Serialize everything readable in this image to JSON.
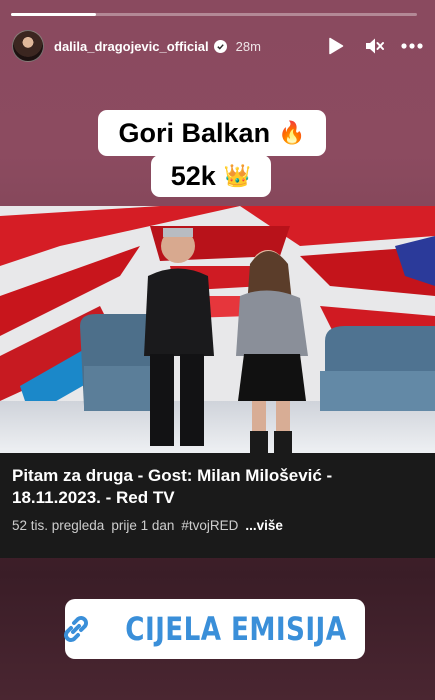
{
  "story": {
    "progress": 0.21
  },
  "header": {
    "username": "dalila_dragojevic_official",
    "time": "28m",
    "verified": true,
    "icons": [
      "play-icon",
      "mute-icon",
      "more-icon"
    ]
  },
  "stickers": {
    "line1_text": "Gori Balkan",
    "line1_emoji": "🔥",
    "line2_text": "52k",
    "line2_emoji": "👑"
  },
  "video": {
    "title": "Pitam za druga - Gost: Milan Milošević - 18.11.2023. - Red TV",
    "views": "52 tis. pregleda",
    "age": "prije 1 dan",
    "hashtag": "#tvojRED",
    "more": "...više"
  },
  "link": {
    "label": "CIJELA EMISIJA",
    "color": "#3a8fd9"
  }
}
